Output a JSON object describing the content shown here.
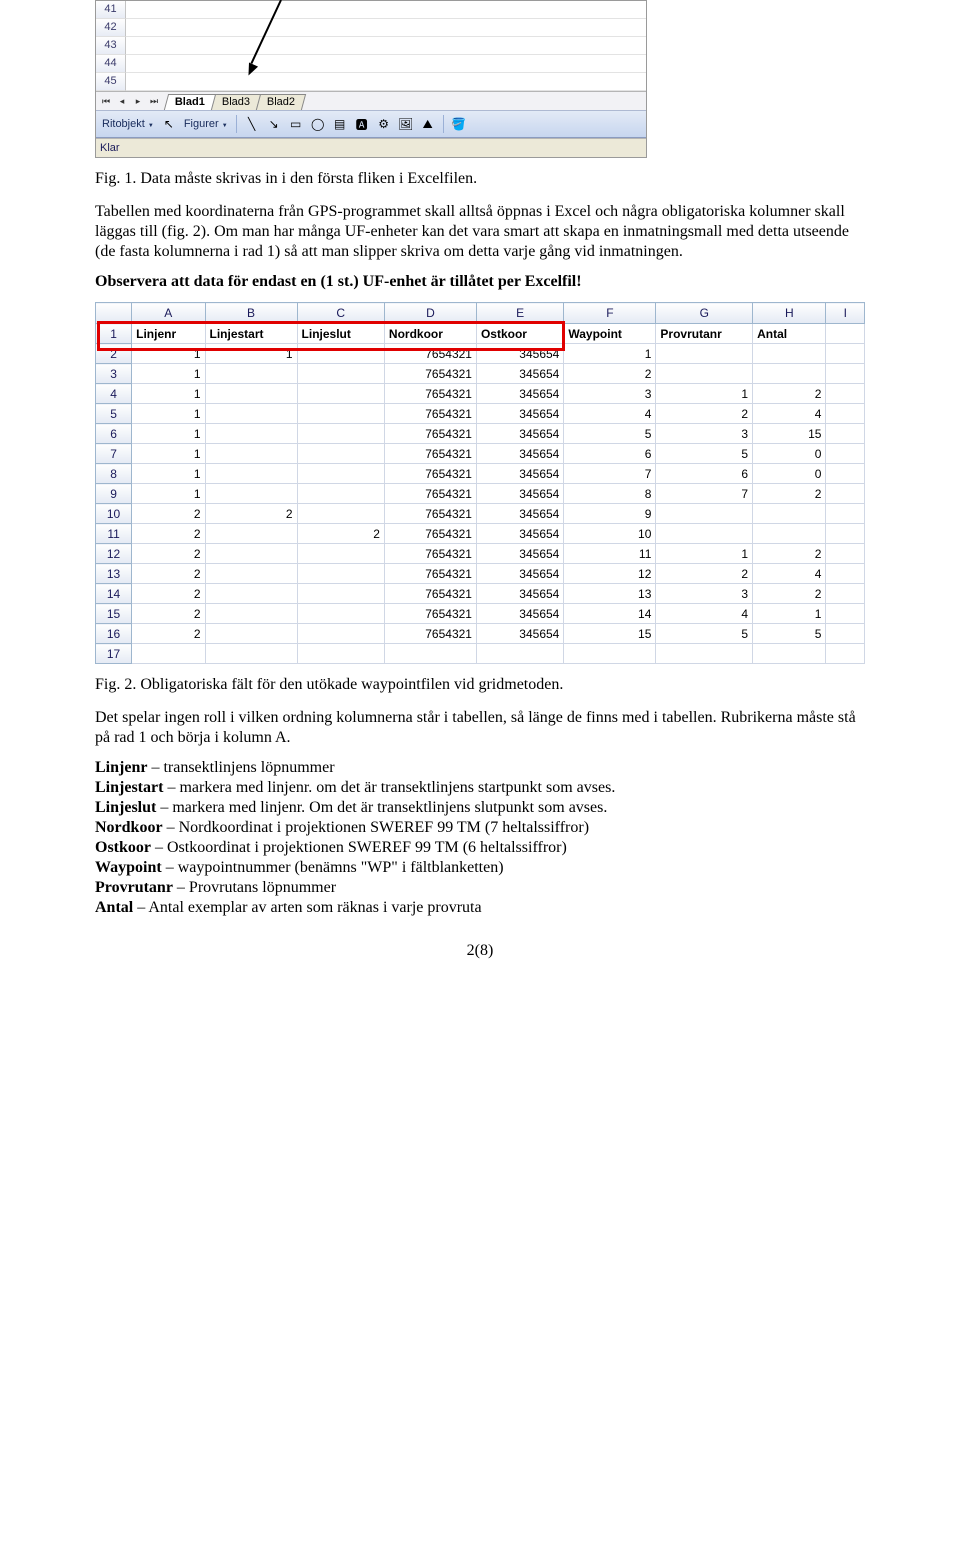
{
  "excel1": {
    "row_numbers": [
      "41",
      "42",
      "43",
      "44",
      "45"
    ],
    "nav": {
      "first": "⏮",
      "prev": "◂",
      "next": "▸",
      "last": "⏭"
    },
    "tabs": [
      "Blad1",
      "Blad3",
      "Blad2"
    ],
    "toolbar": {
      "ritobjekt": "Ritobjekt",
      "figurer": "Figurer"
    },
    "status": "Klar"
  },
  "para1_caption": "Fig. 1. Data måste skrivas in i den första fliken i Excelfilen.",
  "para2": "Tabellen med koordinaterna från GPS-programmet skall alltså öppnas i Excel och några obligatoriska kolumner skall läggas till (fig. 2). Om man har många UF-enheter kan det vara smart att skapa en inmatningsmall med detta utseende (de fasta kolumnerna i rad 1) så att man slipper skriva om detta varje gång vid inmatningen.",
  "para3": "Observera att data för endast en (1 st.) UF-enhet är tillåtet per Excelfil!",
  "table2": {
    "col_letters": [
      "A",
      "B",
      "C",
      "D",
      "E",
      "F",
      "G",
      "H",
      "I"
    ],
    "headers": [
      "Linjenr",
      "Linjestart",
      "Linjeslut",
      "Nordkoor",
      "Ostkoor",
      "Waypoint",
      "Provrutanr",
      "Antal"
    ],
    "rows": [
      {
        "n": 2,
        "c": [
          "1",
          "1",
          "",
          "7654321",
          "345654",
          "1",
          "",
          ""
        ]
      },
      {
        "n": 3,
        "c": [
          "1",
          "",
          "",
          "7654321",
          "345654",
          "2",
          "",
          ""
        ]
      },
      {
        "n": 4,
        "c": [
          "1",
          "",
          "",
          "7654321",
          "345654",
          "3",
          "1",
          "2"
        ]
      },
      {
        "n": 5,
        "c": [
          "1",
          "",
          "",
          "7654321",
          "345654",
          "4",
          "2",
          "4"
        ]
      },
      {
        "n": 6,
        "c": [
          "1",
          "",
          "",
          "7654321",
          "345654",
          "5",
          "3",
          "15"
        ]
      },
      {
        "n": 7,
        "c": [
          "1",
          "",
          "",
          "7654321",
          "345654",
          "6",
          "5",
          "0"
        ]
      },
      {
        "n": 8,
        "c": [
          "1",
          "",
          "",
          "7654321",
          "345654",
          "7",
          "6",
          "0"
        ]
      },
      {
        "n": 9,
        "c": [
          "1",
          "",
          "",
          "7654321",
          "345654",
          "8",
          "7",
          "2"
        ]
      },
      {
        "n": 10,
        "c": [
          "2",
          "2",
          "",
          "7654321",
          "345654",
          "9",
          "",
          ""
        ]
      },
      {
        "n": 11,
        "c": [
          "2",
          "",
          "2",
          "7654321",
          "345654",
          "10",
          "",
          ""
        ]
      },
      {
        "n": 12,
        "c": [
          "2",
          "",
          "",
          "7654321",
          "345654",
          "11",
          "1",
          "2"
        ]
      },
      {
        "n": 13,
        "c": [
          "2",
          "",
          "",
          "7654321",
          "345654",
          "12",
          "2",
          "4"
        ]
      },
      {
        "n": 14,
        "c": [
          "2",
          "",
          "",
          "7654321",
          "345654",
          "13",
          "3",
          "2"
        ]
      },
      {
        "n": 15,
        "c": [
          "2",
          "",
          "",
          "7654321",
          "345654",
          "14",
          "4",
          "1"
        ]
      },
      {
        "n": 16,
        "c": [
          "2",
          "",
          "",
          "7654321",
          "345654",
          "15",
          "5",
          "5"
        ]
      },
      {
        "n": 17,
        "c": [
          "",
          "",
          "",
          "",
          "",
          "",
          "",
          ""
        ]
      }
    ]
  },
  "para4_caption": "Fig. 2. Obligatoriska fält för den utökade waypointfilen vid gridmetoden.",
  "para5": "Det spelar ingen roll i vilken ordning kolumnerna står i tabellen, så länge de finns med i tabellen. Rubrikerna måste stå på rad 1 och börja i kolumn A.",
  "defs": [
    {
      "term": "Linjenr",
      "sep": " – ",
      "desc": "transektlinjens löpnummer"
    },
    {
      "term": "Linjestart",
      "sep": " – ",
      "desc": "markera med linjenr. om det är transektlinjens startpunkt som avses."
    },
    {
      "term": "Linjeslut",
      "sep": " – ",
      "desc": "markera med linjenr. Om det är transektlinjens slutpunkt som avses."
    },
    {
      "term": "Nordkoor",
      "sep": " – ",
      "desc": "Nordkoordinat i projektionen SWEREF 99 TM (7 heltalssiffror)"
    },
    {
      "term": "Ostkoor",
      "sep": " – ",
      "desc": "Ostkoordinat i projektionen SWEREF 99 TM (6 heltalssiffror)"
    },
    {
      "term": "Waypoint",
      "sep": " – ",
      "desc": "waypointnummer (benämns \"WP\" i fältblanketten)"
    },
    {
      "term": "Provrutanr",
      "sep": " – ",
      "desc": "Provrutans löpnummer"
    },
    {
      "term": "Antal",
      "sep": " – ",
      "desc": "Antal exemplar av arten som räknas i varje provruta"
    }
  ],
  "pagenum": "2(8)"
}
